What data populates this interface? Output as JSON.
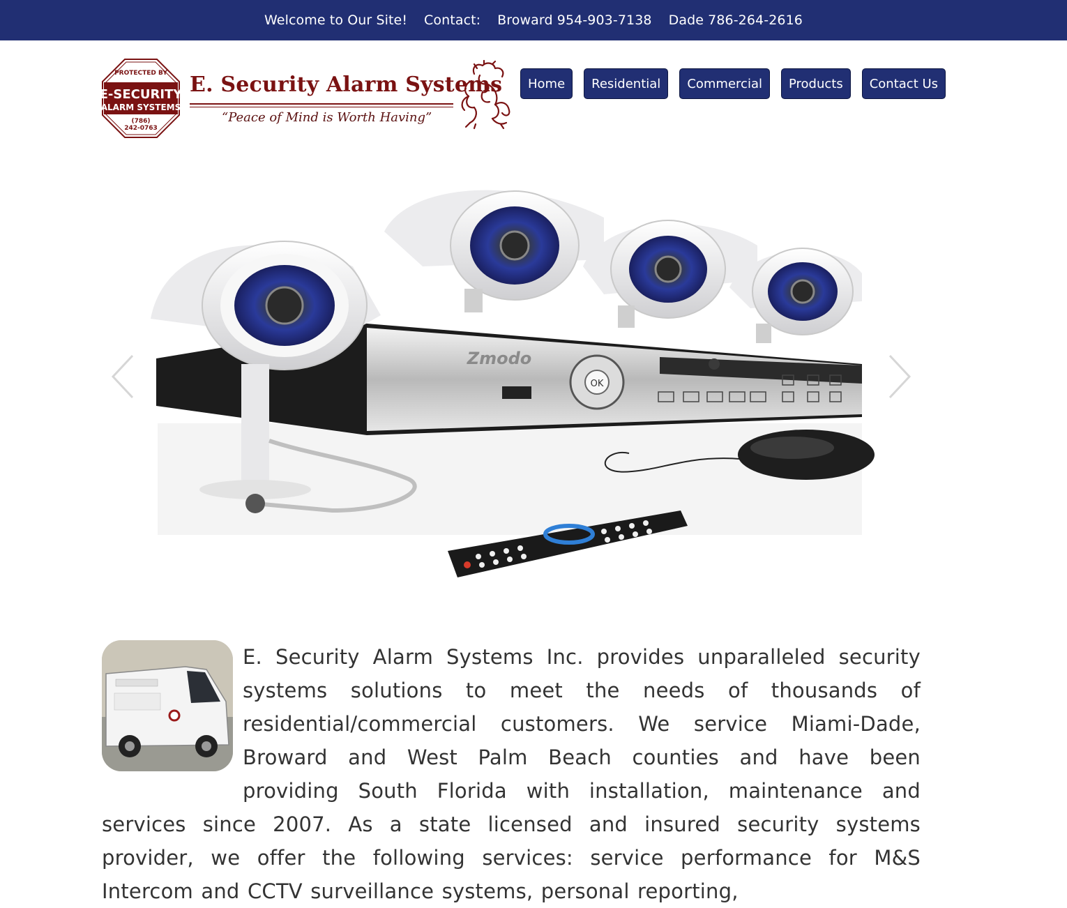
{
  "topbar": {
    "welcome": "Welcome to Our Site!",
    "contact_label": "Contact:",
    "broward": "Broward 954-903-7138",
    "dade": "Dade 786-264-2616"
  },
  "logo": {
    "sign_top": "PROTECTED BY",
    "sign_brand": "E-SECURITY",
    "sign_sub": "ALARM SYSTEMS",
    "sign_phone_area": "(786)",
    "sign_phone": "242-0763",
    "title": "E. Security Alarm Systems",
    "tagline": "“Peace of Mind is Worth Having”"
  },
  "nav": {
    "items": [
      {
        "label": "Home"
      },
      {
        "label": "Residential"
      },
      {
        "label": "Commercial"
      },
      {
        "label": "Products"
      },
      {
        "label": "Contact Us"
      }
    ]
  },
  "hero": {
    "brand_text": "Zmodo",
    "ok_label": "OK"
  },
  "content": {
    "intro": "E. Security Alarm Systems Inc. provides unparalleled security systems solutions to meet the needs of thousands of residential/commercial customers. We service Miami-Dade, Broward and West Palm Beach counties and have been providing South Florida with installation, maintenance and services since 2007. As a state licensed and insured security systems provider, we offer the following services: service performance for M&S Intercom and CCTV surveillance systems, personal reporting,"
  },
  "colors": {
    "brand_navy": "#212f73",
    "logo_red": "#7a1212"
  }
}
